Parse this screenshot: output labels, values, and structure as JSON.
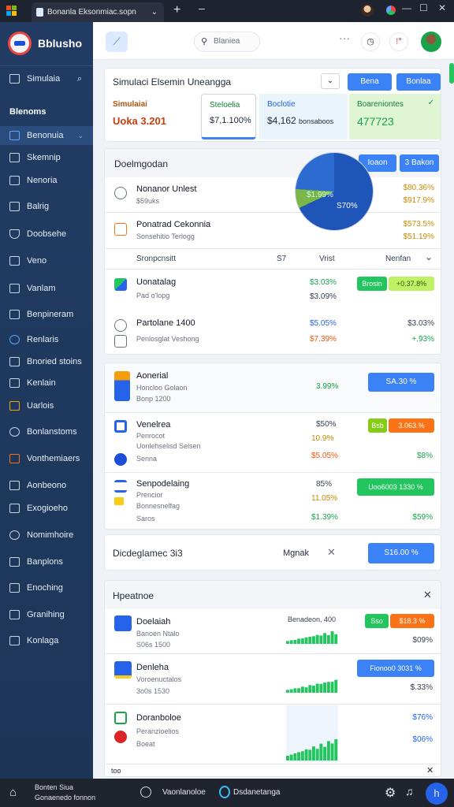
{
  "browser": {
    "tab_title": "Bonanla Eksonmiac.sopn",
    "colors": {
      "bar": "#1e2330"
    }
  },
  "sidebar": {
    "brand": "Bblusho",
    "section_header": "Blenoms",
    "items": [
      {
        "label": "Simulaia",
        "icon": "home-icon"
      },
      {
        "label": "Benonuia",
        "icon": "monitor-icon"
      },
      {
        "label": "Skemnip",
        "icon": "layers-icon"
      },
      {
        "label": "Nenoria",
        "icon": "mail-icon"
      },
      {
        "label": "Balrig",
        "icon": "box-icon"
      },
      {
        "label": "Doobsehe",
        "icon": "shield-icon"
      },
      {
        "label": "Veno",
        "icon": "folder-icon"
      },
      {
        "label": "Vanlam",
        "icon": "grid-icon"
      },
      {
        "label": "Benpineram",
        "icon": "edit-icon"
      },
      {
        "label": "Renlaris",
        "icon": "users-icon"
      },
      {
        "label": "Bnoried stoins",
        "icon": "chart-icon"
      },
      {
        "label": "Kenlain",
        "icon": "file-icon"
      },
      {
        "label": "Uarlois",
        "icon": "archive-icon"
      },
      {
        "label": "Bonlanstoms",
        "icon": "settings-icon"
      },
      {
        "label": "Vonthemiaers",
        "icon": "tools-icon"
      },
      {
        "label": "Aonbeono",
        "icon": "cart-icon"
      },
      {
        "label": "Exogioeho",
        "icon": "briefcase-icon"
      },
      {
        "label": "Nomimhoire",
        "icon": "network-icon"
      },
      {
        "label": "Banplons",
        "icon": "book-icon"
      },
      {
        "label": "Enoching",
        "icon": "pen-icon"
      },
      {
        "label": "Granihing",
        "icon": "graph-icon"
      },
      {
        "label": "Konlaga",
        "icon": "tag-icon"
      }
    ]
  },
  "topbar": {
    "search_placeholder": "Blaniea"
  },
  "summary": {
    "title": "Simulaci Elsemin Uneangga",
    "buttons": [
      "Bena",
      "Bonlaa"
    ],
    "metrics": [
      {
        "label": "Simulaiai",
        "value": "Uoka 3.201"
      },
      {
        "label": "Steloelia",
        "value": "$7,1.100%"
      },
      {
        "label": "Boclotie",
        "value": "$4,162",
        "suffix": "bonsaboos"
      },
      {
        "label": "Boareniontes",
        "value": "477723"
      }
    ],
    "colors": {
      "accent": "#3b82f6",
      "highlight": "#e0f5d4"
    }
  },
  "analysis": {
    "title": "Doelmgodan",
    "buttons": [
      "Ioaon",
      "3 Bakon"
    ],
    "pie": {
      "slices": [
        68,
        8,
        24
      ],
      "labels": [
        "$1.99%",
        "S70%"
      ]
    },
    "items": [
      {
        "title": "Nonanor Unlest",
        "sub": "$59uks",
        "v1": "$80.36%",
        "v2": "$917.9%"
      },
      {
        "title": "Ponatrad Cekonnia",
        "sub": "Sonsehitio Terlogg",
        "v1": "$573.5%",
        "v2": "$51.19%"
      }
    ],
    "columns": [
      "Sronpcnsitt",
      "S7",
      "Vrist",
      "Nenfan"
    ],
    "rows": [
      {
        "title": "Uonatalag",
        "sub": "Pad o'lopg",
        "v1": "$3.03%",
        "v2": "$3.09%",
        "pills": [
          "Brosin",
          "+0.37.8%"
        ]
      },
      {
        "title": "Partolane 1400",
        "sub": "Penlosglat Veshong",
        "v1": "$5.05%",
        "v2": "$7.39%",
        "v3": "$3.03%",
        "v4": "+.93%"
      }
    ]
  },
  "holdings": {
    "rows": [
      {
        "title": "Aonerial",
        "sub": "Honcloo Golaon",
        "sub2": "Bonp 1200",
        "v1": "3.99%",
        "pill": "SA.30 %"
      },
      {
        "title": "Venelrea",
        "sub": "Penrocot",
        "sub2": "Uonlehselisd Selsen",
        "sub3": "Senna",
        "v1": "$50%",
        "v2": "10.9%",
        "v3": "$5.05%",
        "v4": "$8%",
        "pills": [
          "Bsb",
          "3.063.%"
        ]
      },
      {
        "title": "Senpodelaing",
        "sub": "Prencior",
        "sub2": "Bonnesnelfag",
        "sub3": "Saros",
        "v1": "85%",
        "v2": "11.05%",
        "v3": "$1.39%",
        "v4": "$59%",
        "pill": "Uoo6003 1330 %"
      }
    ]
  },
  "dialog": {
    "title": "Dicdeglamec 3i3",
    "right_label": "Mgnak",
    "button": "S16.00 %"
  },
  "recent": {
    "title": "Hpeatnoe",
    "rows": [
      {
        "title": "Doelaiah",
        "sub": "Banoen Ntalo",
        "sub2": "S06s 1500",
        "caption": "Benadeon, 400",
        "value": "$09%",
        "pills": [
          "Sso",
          "$18.3 %"
        ]
      },
      {
        "title": "Denleha",
        "sub": "Voroenuctalos",
        "sub2": "3o0s 1530",
        "value": "$.33%",
        "pill": "Fionoo0 3031 %"
      },
      {
        "title": "Doranboloe",
        "sub": "Peranzioelios",
        "sub2": "Boeat",
        "v1": "$76%",
        "v2": "$06%"
      }
    ],
    "footer_left": "too"
  },
  "statusbar": {
    "left_line1": "Bonten Siua",
    "left_line2": "Gonaenedo fonnon",
    "center": "Vaonlanoloe",
    "center2": "Dsdanetanga"
  }
}
